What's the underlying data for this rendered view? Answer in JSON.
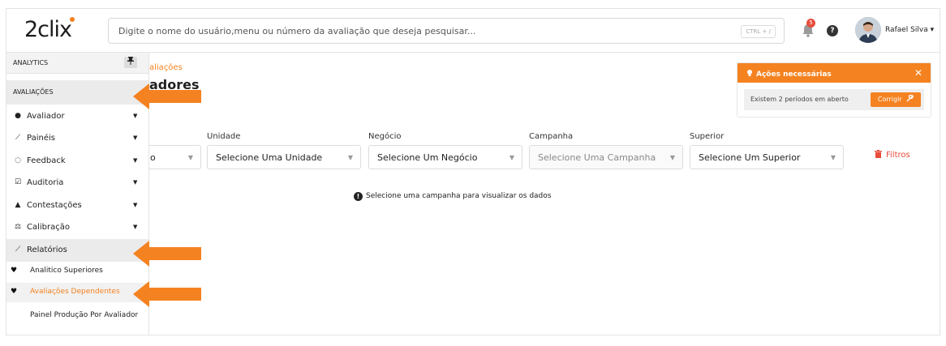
{
  "header": {
    "logo_text": "2clix",
    "search_placeholder": "Digite o nome do usuário,menu ou número da avaliação que deseja pesquisar...",
    "search_shortcut": "CTRL + /",
    "notifications_count": "5",
    "help_label": "?",
    "user_name": "Rafael Silva",
    "user_caret": "▾"
  },
  "sidebar": {
    "analytics_label": "ANALYTICS",
    "pin_icon": "pushpin-icon",
    "avaliacoes_label": "AVALIAÇÕES",
    "items": [
      {
        "label": "Avaliador",
        "icon": "user-circle-icon",
        "glyph": "●"
      },
      {
        "label": "Painéis",
        "icon": "line-chart-icon",
        "glyph": "⟋"
      },
      {
        "label": "Feedback",
        "icon": "chat-bubbles-icon",
        "glyph": "◌"
      },
      {
        "label": "Auditoria",
        "icon": "checkbox-icon",
        "glyph": "☑"
      },
      {
        "label": "Contestações",
        "icon": "warning-triangle-icon",
        "glyph": "▲"
      },
      {
        "label": "Calibração",
        "icon": "balance-scale-icon",
        "glyph": "⚖"
      },
      {
        "label": "Relatórios",
        "icon": "line-chart-icon",
        "glyph": "⟋"
      }
    ],
    "submenu": [
      {
        "label": "Analitico Superiores",
        "icon": "heart-icon",
        "glyph": "♥"
      },
      {
        "label": "Avaliações Dependentes",
        "icon": "heart-icon",
        "glyph": "♥"
      }
    ],
    "multi_item": "Painel Produção Por Avaliador",
    "caret": "▼"
  },
  "main": {
    "breadcrumb": "aliações",
    "page_title": "adores",
    "filters": [
      {
        "label": "",
        "value": "o"
      },
      {
        "label": "Unidade",
        "value": "Selecione Uma Unidade"
      },
      {
        "label": "Negócio",
        "value": "Selecione Um Negócio"
      },
      {
        "label": "Campanha",
        "value": "Selecione Uma Campanha"
      },
      {
        "label": "Superior",
        "value": "Selecione Um Superior"
      }
    ],
    "select_caret": "▼",
    "filters_button": "Filtros",
    "trash_icon": "trash-icon",
    "info_icon_glyph": "!",
    "info_message": "Selecione uma campanha para visualizar os dados"
  },
  "actions_card": {
    "title": "Ações necessárias",
    "icon": "lightbulb-icon",
    "close_glyph": "✕",
    "message": "Existem 2 períodos em aberto",
    "button_label": "Corrigir",
    "button_icon": "wrench-icon"
  },
  "colors": {
    "accent": "#f58220",
    "danger": "#e74c3c"
  }
}
